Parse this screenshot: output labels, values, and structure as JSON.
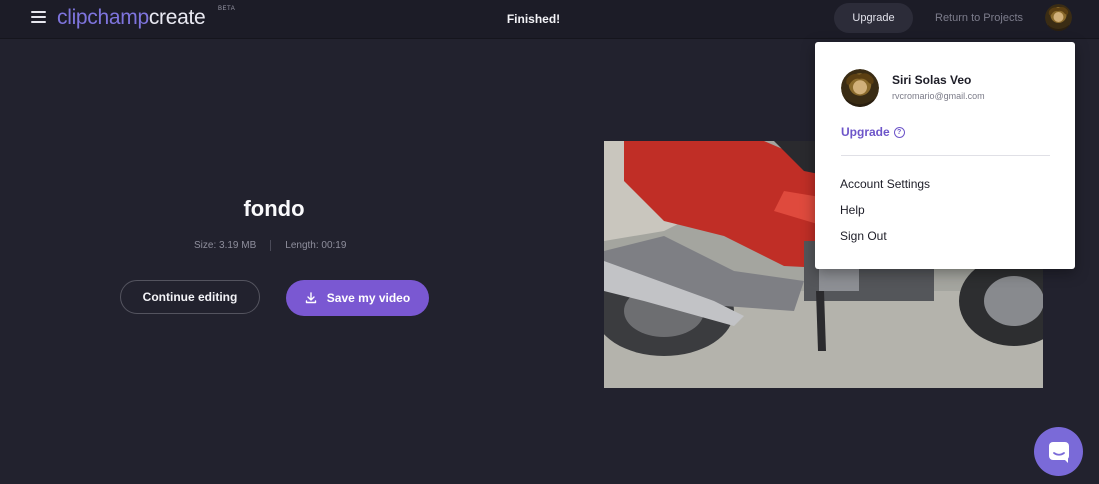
{
  "header": {
    "logo_part1": "clipchamp",
    "logo_part2": "create",
    "beta_label": "BETA",
    "status": "Finished!",
    "upgrade_label": "Upgrade",
    "return_label": "Return to Projects"
  },
  "project": {
    "title": "fondo",
    "size_text": "Size: 3.19 MB",
    "length_text": "Length: 00:19",
    "continue_label": "Continue editing",
    "save_label": "Save my video"
  },
  "user_menu": {
    "name": "Siri Solas Veo",
    "email": "rvcromario@gmail.com",
    "upgrade_label": "Upgrade",
    "upgrade_help_glyph": "?",
    "items": [
      {
        "label": "Account Settings"
      },
      {
        "label": "Help"
      },
      {
        "label": "Sign Out"
      }
    ]
  },
  "icons": {
    "menu": "hamburger-icon",
    "download": "download-icon",
    "chat": "chat-icon",
    "help": "question-circle-icon"
  },
  "colors": {
    "accent": "#7a58d2",
    "brand": "#7e74dd",
    "background": "#22222e",
    "topbar": "#1c1c27"
  }
}
